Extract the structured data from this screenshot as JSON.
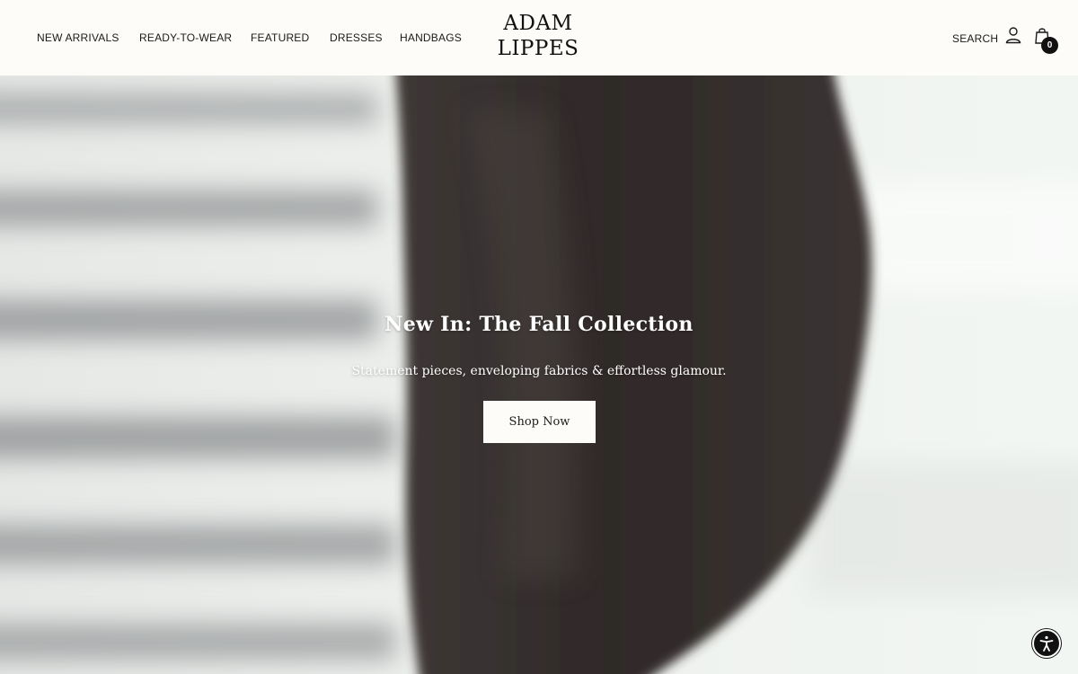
{
  "header": {
    "nav": [
      {
        "label": "NEW ARRIVALS"
      },
      {
        "label": "READY-TO-WEAR"
      },
      {
        "label": "FEATURED"
      },
      {
        "label": "DRESSES"
      },
      {
        "label": "HANDBAGS"
      }
    ],
    "logo": {
      "line1": "ADAM",
      "line2": "LIPPES"
    },
    "search_label": "SEARCH",
    "account_icon": "user-icon",
    "cart_icon": "shopping-bag-icon",
    "cart_count": "0"
  },
  "hero": {
    "title": "New In: The Fall Collection",
    "subtitle": "Statement pieces, enveloping fabrics & effortless glamour.",
    "cta_label": "Shop Now"
  },
  "accessibility": {
    "icon": "accessibility-icon"
  },
  "colors": {
    "header_bg": "#fdfcf9",
    "text": "#1a1a1a",
    "button_bg": "#fdfcf9",
    "hero_text": "#ffffff"
  }
}
